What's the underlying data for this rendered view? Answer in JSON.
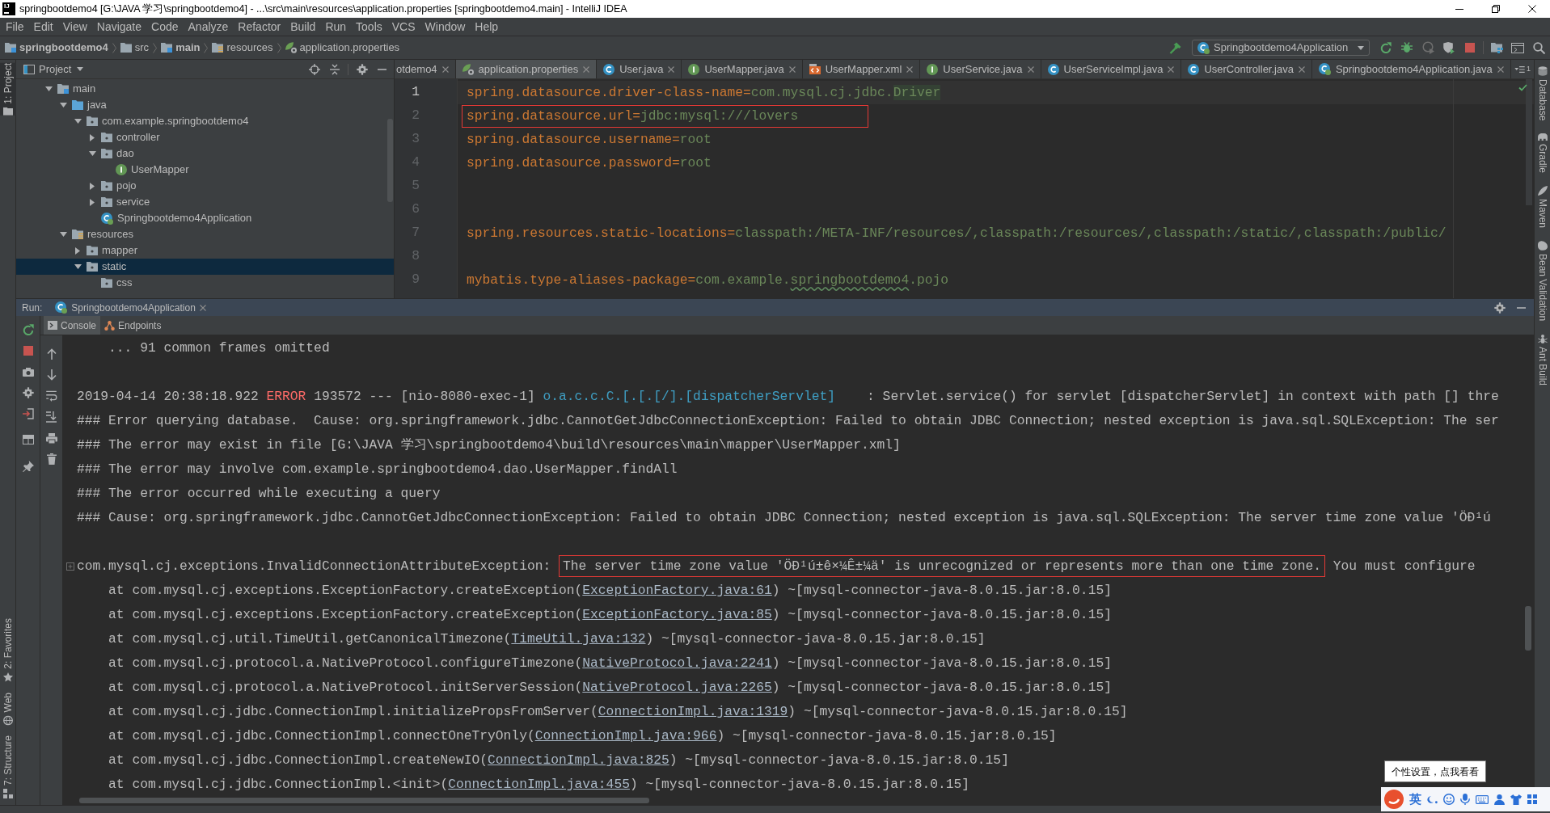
{
  "window": {
    "logo": "IJ",
    "title": "springbootdemo4 [G:\\JAVA 学习\\springbootdemo4] - ...\\src\\main\\resources\\application.properties [springbootdemo4.main] - IntelliJ IDEA"
  },
  "menu": [
    "File",
    "Edit",
    "View",
    "Navigate",
    "Code",
    "Analyze",
    "Refactor",
    "Build",
    "Run",
    "Tools",
    "VCS",
    "Window",
    "Help"
  ],
  "breadcrumbs": [
    {
      "label": "springbootdemo4",
      "kind": "module"
    },
    {
      "label": "src",
      "kind": "folder"
    },
    {
      "label": "main",
      "kind": "source-set"
    },
    {
      "label": "resources",
      "kind": "resource-root"
    },
    {
      "label": "application.properties",
      "kind": "properties"
    }
  ],
  "run_configuration": {
    "label": "Springbootdemo4Application"
  },
  "left_stripe": {
    "top": [
      {
        "label": "1: Project",
        "kind": "project",
        "selected": true
      }
    ],
    "bottom": [
      {
        "label": "2: Favorites",
        "kind": "favorites",
        "selected": false
      },
      {
        "label": "Web",
        "kind": "web",
        "selected": false
      },
      {
        "label": "7: Structure",
        "kind": "structure",
        "selected": false
      }
    ]
  },
  "project_panel": {
    "title": "Project",
    "tree": [
      {
        "label": "main",
        "kind": "source-set",
        "expanded": true,
        "selected": false,
        "children": [
          {
            "label": "java",
            "kind": "source-root",
            "expanded": true,
            "selected": false,
            "children": [
              {
                "label": "com.example.springbootdemo4",
                "kind": "package",
                "expanded": true,
                "selected": false,
                "children": [
                  {
                    "label": "controller",
                    "kind": "package",
                    "expanded": false,
                    "selected": false
                  },
                  {
                    "label": "dao",
                    "kind": "package",
                    "expanded": true,
                    "selected": false,
                    "children": [
                      {
                        "label": "UserMapper",
                        "kind": "interface",
                        "selected": false
                      }
                    ]
                  },
                  {
                    "label": "pojo",
                    "kind": "package",
                    "expanded": false,
                    "selected": false
                  },
                  {
                    "label": "service",
                    "kind": "package",
                    "expanded": false,
                    "selected": false
                  },
                  {
                    "label": "Springbootdemo4Application",
                    "kind": "application",
                    "selected": false
                  }
                ]
              }
            ]
          },
          {
            "label": "resources",
            "kind": "resource-root",
            "expanded": true,
            "selected": false,
            "children": [
              {
                "label": "mapper",
                "kind": "package",
                "expanded": false,
                "selected": false
              },
              {
                "label": "static",
                "kind": "package",
                "expanded": true,
                "selected": true,
                "children": [
                  {
                    "label": "css",
                    "kind": "package",
                    "selected": false
                  }
                ]
              }
            ]
          }
        ]
      }
    ]
  },
  "editor": {
    "tabs": [
      {
        "label": "otdemo4",
        "kind": "truncated",
        "selected": false
      },
      {
        "label": "application.properties",
        "kind": "properties",
        "selected": true
      },
      {
        "label": "User.java",
        "kind": "class",
        "selected": false
      },
      {
        "label": "UserMapper.java",
        "kind": "interface",
        "selected": false
      },
      {
        "label": "UserMapper.xml",
        "kind": "xml",
        "selected": false
      },
      {
        "label": "UserService.java",
        "kind": "interface",
        "selected": false
      },
      {
        "label": "UserServiceImpl.java",
        "kind": "class",
        "selected": false
      },
      {
        "label": "UserController.java",
        "kind": "class",
        "selected": false
      },
      {
        "label": "Springbootdemo4Application.java",
        "kind": "application",
        "selected": false
      }
    ],
    "overflow_count": "1",
    "lines": [
      {
        "number": "1",
        "current": true,
        "boxed": false,
        "segments": [
          {
            "kind": "key",
            "text": "spring.datasource.driver-class-name"
          },
          {
            "kind": "separator",
            "text": "="
          },
          {
            "kind": "value",
            "text": "com.mysql.cj.jdbc."
          },
          {
            "kind": "highlighted",
            "text": "Driver"
          }
        ]
      },
      {
        "number": "2",
        "current": false,
        "boxed": true,
        "segments": [
          {
            "kind": "key",
            "text": "spring.datasource.url"
          },
          {
            "kind": "separator",
            "text": "="
          },
          {
            "kind": "value",
            "text": "jdbc:mysql:///lovers"
          }
        ]
      },
      {
        "number": "3",
        "current": false,
        "boxed": false,
        "segments": [
          {
            "kind": "key",
            "text": "spring.datasource.username"
          },
          {
            "kind": "separator",
            "text": "="
          },
          {
            "kind": "value",
            "text": "root"
          }
        ]
      },
      {
        "number": "4",
        "current": false,
        "boxed": false,
        "segments": [
          {
            "kind": "key",
            "text": "spring.datasource.password"
          },
          {
            "kind": "separator",
            "text": "="
          },
          {
            "kind": "value",
            "text": "root"
          }
        ]
      },
      {
        "number": "5",
        "current": false,
        "boxed": false
      },
      {
        "number": "6",
        "current": false,
        "boxed": false
      },
      {
        "number": "7",
        "current": false,
        "boxed": false,
        "segments": [
          {
            "kind": "key",
            "text": "spring.resources.static-locations"
          },
          {
            "kind": "separator",
            "text": "="
          },
          {
            "kind": "value",
            "text": "classpath:/META-INF/resources/,classpath:/resources/,classpath:/static/,classpath:/public/"
          }
        ]
      },
      {
        "number": "8",
        "current": false,
        "boxed": false
      },
      {
        "number": "9",
        "current": false,
        "boxed": false,
        "segments": [
          {
            "kind": "key",
            "text": "mybatis.type-aliases-package"
          },
          {
            "kind": "separator",
            "text": "="
          },
          {
            "kind": "value",
            "text": "com.example."
          },
          {
            "kind": "misspelled",
            "text": "springbootdemo4"
          },
          {
            "kind": "value",
            "text": ".pojo"
          }
        ]
      }
    ]
  },
  "right_stripe": [
    {
      "label": "Database",
      "kind": "database",
      "selected": false
    },
    {
      "label": "Gradle",
      "kind": "gradle",
      "selected": false
    },
    {
      "label": "Maven",
      "kind": "maven",
      "selected": false
    },
    {
      "label": "Bean Validation",
      "kind": "bean-validation",
      "selected": false
    },
    {
      "label": "Ant Build",
      "kind": "ant",
      "selected": false
    }
  ],
  "run_panel": {
    "label": "Run:",
    "tabs": [
      {
        "label": "Springbootdemo4Application"
      }
    ],
    "subtabs": [
      {
        "label": "Console",
        "kind": "console",
        "selected": true
      },
      {
        "label": "Endpoints",
        "kind": "endpoints",
        "selected": false
      }
    ],
    "console": {
      "lines": [
        {
          "kind": "frame",
          "segments": [
            {
              "kind": "plain",
              "text": "... 91 common frames omitted"
            }
          ]
        },
        {
          "kind": "blank"
        },
        {
          "kind": "log",
          "segments": [
            {
              "kind": "plain",
              "text": "2019-04-14 20:38:18.922 "
            },
            {
              "kind": "level",
              "text": "ERROR"
            },
            {
              "kind": "plain",
              "text": " 193572 --- [nio-8080-exec-1] "
            },
            {
              "kind": "logger",
              "text": "o.a.c.c.C.[.[.[/].[dispatcherServlet]"
            },
            {
              "kind": "plain",
              "text": "    : Servlet.service() for servlet [dispatcherServlet] in context with path [] thre"
            }
          ]
        },
        {
          "kind": "log",
          "segments": [
            {
              "kind": "plain",
              "text": "### Error querying database.  Cause: org.springframework.jdbc.CannotGetJdbcConnectionException: Failed to obtain JDBC Connection; nested exception is java.sql.SQLException: The ser"
            }
          ]
        },
        {
          "kind": "log",
          "segments": [
            {
              "kind": "plain",
              "text": "### The error may exist in file [G:\\JAVA 学习\\springbootdemo4\\build\\resources\\main\\mapper\\UserMapper.xml]"
            }
          ]
        },
        {
          "kind": "log",
          "segments": [
            {
              "kind": "plain",
              "text": "### The error may involve com.example.springbootdemo4.dao.UserMapper.findAll"
            }
          ]
        },
        {
          "kind": "log",
          "segments": [
            {
              "kind": "plain",
              "text": "### The error occurred while executing a query"
            }
          ]
        },
        {
          "kind": "log",
          "segments": [
            {
              "kind": "plain",
              "text": "### Cause: org.springframework.jdbc.CannotGetJdbcConnectionException: Failed to obtain JDBC Connection; nested exception is java.sql.SQLException: The server time zone value 'ÖÐ¹ú"
            }
          ]
        },
        {
          "kind": "blank"
        },
        {
          "kind": "exception",
          "segments": [
            {
              "kind": "plain",
              "text": "com.mysql.cj.exceptions.InvalidConnectionAttributeException: "
            },
            {
              "kind": "boxed",
              "text": "The server time zone value 'ÖÐ¹ú±ê×¼Ê±¼ä' is unrecognized or represents more than one time zone."
            },
            {
              "kind": "plain",
              "text": " You must configure"
            }
          ]
        },
        {
          "kind": "frame",
          "segments": [
            {
              "kind": "plain",
              "text": "at com.mysql.cj.exceptions.ExceptionFactory.createException("
            },
            {
              "kind": "link",
              "text": "ExceptionFactory.java:61"
            },
            {
              "kind": "plain",
              "text": ") ~[mysql-connector-java-8.0.15.jar:8.0.15]"
            }
          ]
        },
        {
          "kind": "frame",
          "segments": [
            {
              "kind": "plain",
              "text": "at com.mysql.cj.exceptions.ExceptionFactory.createException("
            },
            {
              "kind": "link",
              "text": "ExceptionFactory.java:85"
            },
            {
              "kind": "plain",
              "text": ") ~[mysql-connector-java-8.0.15.jar:8.0.15]"
            }
          ]
        },
        {
          "kind": "frame",
          "segments": [
            {
              "kind": "plain",
              "text": "at com.mysql.cj.util.TimeUtil.getCanonicalTimezone("
            },
            {
              "kind": "link",
              "text": "TimeUtil.java:132"
            },
            {
              "kind": "plain",
              "text": ") ~[mysql-connector-java-8.0.15.jar:8.0.15]"
            }
          ]
        },
        {
          "kind": "frame",
          "segments": [
            {
              "kind": "plain",
              "text": "at com.mysql.cj.protocol.a.NativeProtocol.configureTimezone("
            },
            {
              "kind": "link",
              "text": "NativeProtocol.java:2241"
            },
            {
              "kind": "plain",
              "text": ") ~[mysql-connector-java-8.0.15.jar:8.0.15]"
            }
          ]
        },
        {
          "kind": "frame",
          "segments": [
            {
              "kind": "plain",
              "text": "at com.mysql.cj.protocol.a.NativeProtocol.initServerSession("
            },
            {
              "kind": "link",
              "text": "NativeProtocol.java:2265"
            },
            {
              "kind": "plain",
              "text": ") ~[mysql-connector-java-8.0.15.jar:8.0.15]"
            }
          ]
        },
        {
          "kind": "frame",
          "segments": [
            {
              "kind": "plain",
              "text": "at com.mysql.cj.jdbc.ConnectionImpl.initializePropsFromServer("
            },
            {
              "kind": "link",
              "text": "ConnectionImpl.java:1319"
            },
            {
              "kind": "plain",
              "text": ") ~[mysql-connector-java-8.0.15.jar:8.0.15]"
            }
          ]
        },
        {
          "kind": "frame",
          "segments": [
            {
              "kind": "plain",
              "text": "at com.mysql.cj.jdbc.ConnectionImpl.connectOneTryOnly("
            },
            {
              "kind": "link",
              "text": "ConnectionImpl.java:966"
            },
            {
              "kind": "plain",
              "text": ") ~[mysql-connector-java-8.0.15.jar:8.0.15]"
            }
          ]
        },
        {
          "kind": "frame",
          "segments": [
            {
              "kind": "plain",
              "text": "at com.mysql.cj.jdbc.ConnectionImpl.createNewIO("
            },
            {
              "kind": "link",
              "text": "ConnectionImpl.java:825"
            },
            {
              "kind": "plain",
              "text": ") ~[mysql-connector-java-8.0.15.jar:8.0.15]"
            }
          ]
        },
        {
          "kind": "frame",
          "segments": [
            {
              "kind": "plain",
              "text": "at com.mysql.cj.jdbc.ConnectionImpl.<init>("
            },
            {
              "kind": "link",
              "text": "ConnectionImpl.java:455"
            },
            {
              "kind": "plain",
              "text": ") ~[mysql-connector-java-8.0.15.jar:8.0.15]"
            }
          ]
        }
      ]
    }
  },
  "ime": {
    "mode": "英",
    "tooltip": "个性设置，点我看看"
  }
}
